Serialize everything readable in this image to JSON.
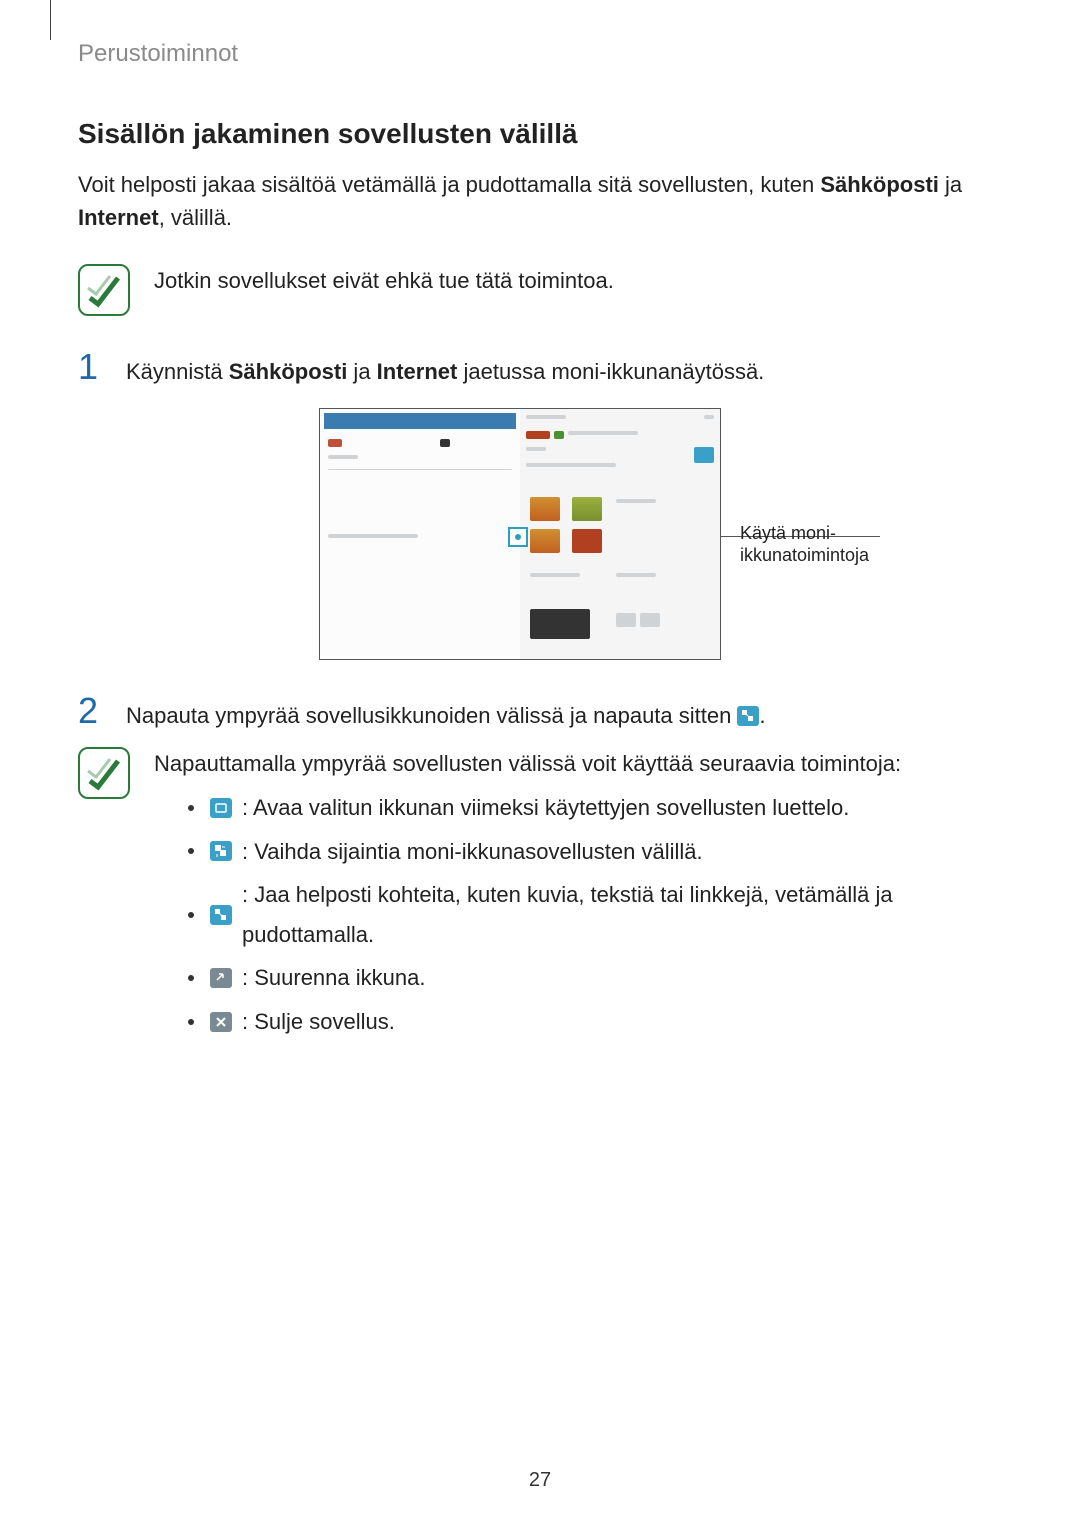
{
  "breadcrumb": "Perustoiminnot",
  "section_title": "Sisällön jakaminen sovellusten välillä",
  "intro": {
    "part1": "Voit helposti jakaa sisältöä vetämällä ja pudottamalla sitä sovellusten, kuten ",
    "bold1": "Sähköposti",
    "part2": " ja ",
    "bold2": "Internet",
    "part3": ", välillä."
  },
  "note1": "Jotkin sovellukset eivät ehkä tue tätä toimintoa.",
  "steps": {
    "one": {
      "num": "1",
      "prefix": "Käynnistä ",
      "bold1": "Sähköposti",
      "mid": " ja ",
      "bold2": "Internet",
      "suffix": " jaetussa moni-ikkunanäytössä."
    },
    "two": {
      "num": "2",
      "prefix": "Napauta ympyrää sovellusikkunoiden välissä ja napauta sitten ",
      "suffix": "."
    }
  },
  "callout": "Käytä moni-ikkunatoimintoja",
  "note2_intro": "Napauttamalla ympyrää sovellusten välissä voit käyttää seuraavia toimintoja:",
  "bullets": {
    "b1": " : Avaa valitun ikkunan viimeksi käytettyjen sovellusten luettelo.",
    "b2": " : Vaihda sijaintia moni-ikkunasovellusten välillä.",
    "b3": " : Jaa helposti kohteita, kuten kuvia, tekstiä tai linkkejä, vetämällä ja pudottamalla.",
    "b4": " : Suurenna ikkuna.",
    "b5": " : Sulje sovellus."
  },
  "page_number": "27"
}
